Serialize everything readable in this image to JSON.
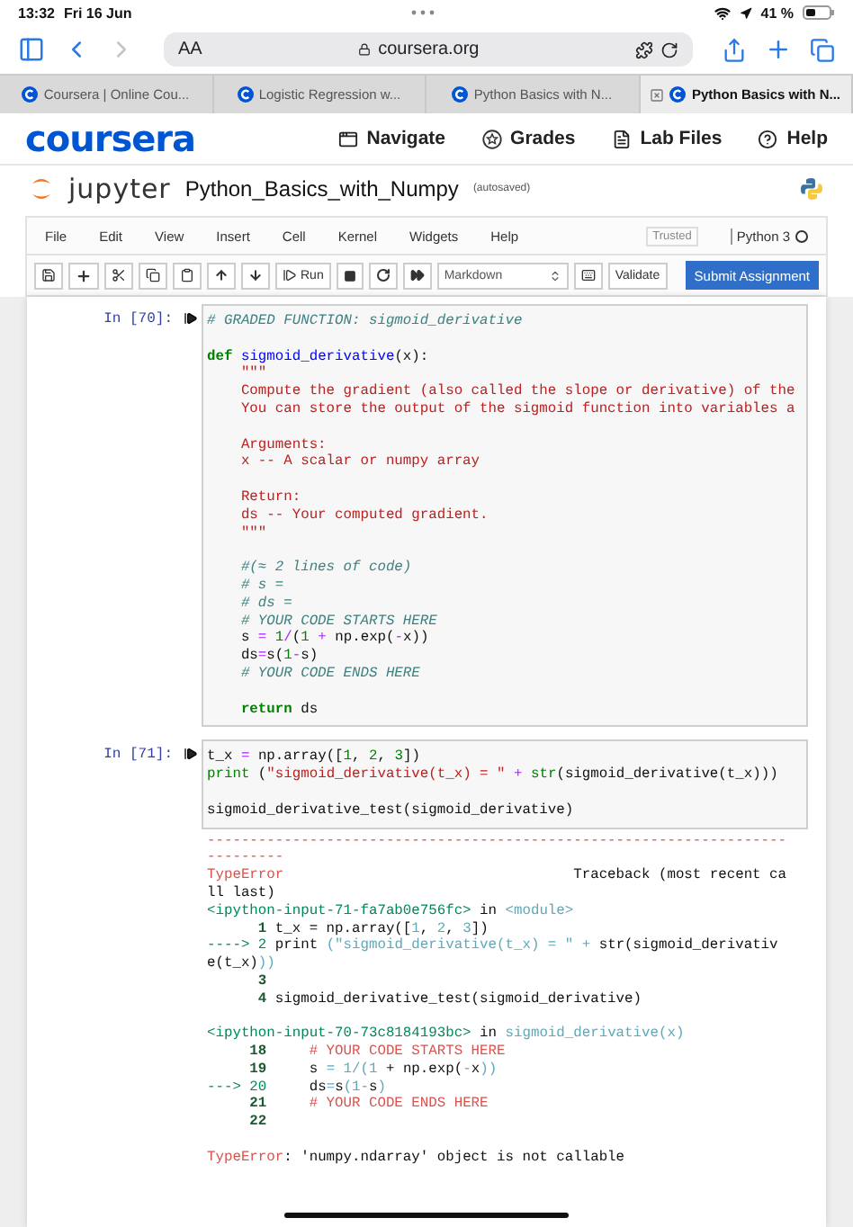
{
  "status_bar": {
    "time": "13:32",
    "date": "Fri 16 Jun",
    "battery": "41 %"
  },
  "browser": {
    "text_size": "AA",
    "address": "coursera.org",
    "forward_enabled": false
  },
  "tabs": [
    {
      "label": "Coursera | Online Cou...",
      "selected": false
    },
    {
      "label": "Logistic Regression w...",
      "selected": false
    },
    {
      "label": "Python Basics with N...",
      "selected": false
    },
    {
      "label": "Python Basics with N...",
      "selected": true
    }
  ],
  "site_nav": {
    "logo": "coursera",
    "items": [
      "Navigate",
      "Grades",
      "Lab Files",
      "Help"
    ]
  },
  "jupyter": {
    "logo": "jupyter",
    "notebook": "Python_Basics_with_Numpy",
    "status": "(autosaved)"
  },
  "menu": [
    "File",
    "Edit",
    "View",
    "Insert",
    "Cell",
    "Kernel",
    "Widgets",
    "Help"
  ],
  "trusted": "Trusted",
  "kernel": {
    "name": "Python 3",
    "busy": false
  },
  "toolbar": {
    "run": "Run",
    "cell_type": "Markdown",
    "validate": "Validate",
    "submit": "Submit Assignment"
  },
  "cells": [
    {
      "prompt": "In [70]:",
      "lines": [
        {
          "gap_before": false,
          "tokens": [
            {
              "text": "# GRADED FUNCTION: sigmoid_derivative",
              "kind": "comment"
            }
          ]
        },
        {
          "gap_before": true,
          "tokens": [
            {
              "text": "def",
              "kind": "keyword"
            },
            {
              "text": " sigmoid_derivative",
              "kind": "name"
            },
            {
              "text": "(x):"
            }
          ]
        },
        {
          "gap_before": false,
          "tokens": [
            {
              "text": "    \"\"\"",
              "kind": "string"
            }
          ]
        },
        {
          "gap_before": false,
          "tokens": [
            {
              "text": "    Compute the gradient (also called the slope or derivative) of the",
              "kind": "string"
            }
          ]
        },
        {
          "gap_before": false,
          "tokens": [
            {
              "text": "    You can store the output of the sigmoid function into variables a",
              "kind": "string"
            }
          ]
        },
        {
          "gap_before": true,
          "tokens": [
            {
              "text": "    Arguments:",
              "kind": "string"
            }
          ]
        },
        {
          "gap_before": false,
          "tokens": [
            {
              "text": "    x -- A scalar or numpy array",
              "kind": "string"
            }
          ]
        },
        {
          "gap_before": true,
          "tokens": [
            {
              "text": "    Return:",
              "kind": "string"
            }
          ]
        },
        {
          "gap_before": false,
          "tokens": [
            {
              "text": "    ds -- Your computed gradient.",
              "kind": "string"
            }
          ]
        },
        {
          "gap_before": false,
          "tokens": [
            {
              "text": "    \"\"\"",
              "kind": "string"
            }
          ]
        },
        {
          "gap_before": true,
          "tokens": [
            {
              "text": "    #(≈ 2 lines of code)",
              "kind": "comment"
            }
          ]
        },
        {
          "gap_before": false,
          "tokens": [
            {
              "text": "    # s = ",
              "kind": "comment"
            }
          ]
        },
        {
          "gap_before": false,
          "tokens": [
            {
              "text": "    # ds = ",
              "kind": "comment"
            }
          ]
        },
        {
          "gap_before": false,
          "tokens": [
            {
              "text": "    # YOUR CODE STARTS HERE",
              "kind": "comment"
            }
          ]
        },
        {
          "gap_before": false,
          "tokens": [
            {
              "text": "    s "
            },
            {
              "text": "= ",
              "kind": "operator"
            },
            {
              "text": "1",
              "kind": "number"
            },
            {
              "text": "/",
              "kind": "operator"
            },
            {
              "text": "("
            },
            {
              "text": "1",
              "kind": "number"
            },
            {
              "text": " + ",
              "kind": "operator"
            },
            {
              "text": "np.exp("
            },
            {
              "text": "-",
              "kind": "operator"
            },
            {
              "text": "x))"
            }
          ]
        },
        {
          "gap_before": false,
          "tokens": [
            {
              "text": "    ds"
            },
            {
              "text": "=",
              "kind": "operator"
            },
            {
              "text": "s("
            },
            {
              "text": "1",
              "kind": "number"
            },
            {
              "text": "-",
              "kind": "operator"
            },
            {
              "text": "s)"
            }
          ]
        },
        {
          "gap_before": false,
          "tokens": [
            {
              "text": "    # YOUR CODE ENDS HERE",
              "kind": "comment"
            }
          ]
        },
        {
          "gap_before": true,
          "tokens": [
            {
              "text": "    return",
              "kind": "keyword"
            },
            {
              "text": " ds"
            }
          ]
        }
      ]
    },
    {
      "prompt": "In [71]:",
      "lines": [
        {
          "gap_before": false,
          "tokens": [
            {
              "text": "t_x "
            },
            {
              "text": "=",
              "kind": "operator"
            },
            {
              "text": " np.array(["
            },
            {
              "text": "1",
              "kind": "number"
            },
            {
              "text": ", "
            },
            {
              "text": "2",
              "kind": "number"
            },
            {
              "text": ", "
            },
            {
              "text": "3",
              "kind": "number"
            },
            {
              "text": "])"
            }
          ]
        },
        {
          "gap_before": false,
          "tokens": [
            {
              "text": "print",
              "kind": "builtin"
            },
            {
              "text": " ("
            },
            {
              "text": "\"sigmoid_derivative(t_x) = \"",
              "kind": "string"
            },
            {
              "text": " + ",
              "kind": "operator"
            },
            {
              "text": "str",
              "kind": "builtin"
            },
            {
              "text": "(sigmoid_derivative(t_x)))"
            }
          ]
        },
        {
          "gap_before": true,
          "tokens": [
            {
              "text": "sigmoid_derivative_test(sigmoid_derivative)"
            }
          ]
        }
      ],
      "output": [
        {
          "gap_before": false,
          "tokens": [
            {
              "text": "--------------------------------------------------------------------",
              "kind": "error"
            }
          ]
        },
        {
          "gap_before": false,
          "tokens": [
            {
              "text": "---------",
              "kind": "error"
            }
          ]
        },
        {
          "gap_before": false,
          "tokens": [
            {
              "text": "TypeError",
              "kind": "error"
            },
            {
              "text": "                                  Traceback (most recent ca"
            }
          ]
        },
        {
          "gap_before": false,
          "tokens": [
            {
              "text": "ll last)"
            }
          ]
        },
        {
          "gap_before": false,
          "tokens": [
            {
              "text": "<ipython-input-71-fa7ab0e756fc>",
              "kind": "green"
            },
            {
              "text": " in "
            },
            {
              "text": "<module>",
              "kind": "cyan"
            }
          ]
        },
        {
          "gap_before": false,
          "tokens": [
            {
              "text": "      1",
              "kind": "lineno"
            },
            {
              "text": " t_x = np.array(["
            },
            {
              "text": "1",
              "kind": "cyan"
            },
            {
              "text": ", "
            },
            {
              "text": "2",
              "kind": "cyan"
            },
            {
              "text": ", "
            },
            {
              "text": "3",
              "kind": "cyan"
            },
            {
              "text": "])"
            }
          ]
        },
        {
          "gap_before": false,
          "tokens": [
            {
              "text": "----> 2",
              "kind": "green"
            },
            {
              "text": " print "
            },
            {
              "text": "(\"sigmoid_derivative(t_x) = \" + ",
              "kind": "cyan"
            },
            {
              "text": "str(sigmoid_derivativ"
            }
          ]
        },
        {
          "gap_before": false,
          "tokens": [
            {
              "text": "e(t_x)"
            },
            {
              "text": "))",
              "kind": "cyan"
            }
          ]
        },
        {
          "gap_before": false,
          "tokens": [
            {
              "text": "      3",
              "kind": "lineno"
            }
          ]
        },
        {
          "gap_before": false,
          "tokens": [
            {
              "text": "      4",
              "kind": "lineno"
            },
            {
              "text": " sigmoid_derivative_test(sigmoid_derivative)"
            }
          ]
        },
        {
          "gap_before": true,
          "tokens": [
            {
              "text": "<ipython-input-70-73c8184193bc>",
              "kind": "green"
            },
            {
              "text": " in "
            },
            {
              "text": "sigmoid_derivative(x)",
              "kind": "cyan"
            }
          ]
        },
        {
          "gap_before": false,
          "tokens": [
            {
              "text": "     18",
              "kind": "lineno"
            },
            {
              "text": "     # YOUR CODE STARTS HERE",
              "kind": "error"
            }
          ]
        },
        {
          "gap_before": false,
          "tokens": [
            {
              "text": "     19",
              "kind": "lineno"
            },
            {
              "text": "     s "
            },
            {
              "text": "= 1/(1",
              "kind": "cyan"
            },
            {
              "text": " + np.exp("
            },
            {
              "text": "-",
              "kind": "cyan"
            },
            {
              "text": "x"
            },
            {
              "text": "))",
              "kind": "cyan"
            }
          ]
        },
        {
          "gap_before": false,
          "tokens": [
            {
              "text": "---> 20",
              "kind": "green"
            },
            {
              "text": "     ds"
            },
            {
              "text": "=",
              "kind": "cyan"
            },
            {
              "text": "s"
            },
            {
              "text": "(1-",
              "kind": "cyan"
            },
            {
              "text": "s"
            },
            {
              "text": ")",
              "kind": "cyan"
            }
          ]
        },
        {
          "gap_before": false,
          "tokens": [
            {
              "text": "     21",
              "kind": "lineno"
            },
            {
              "text": "     # YOUR CODE ENDS HERE",
              "kind": "error"
            }
          ]
        },
        {
          "gap_before": false,
          "tokens": [
            {
              "text": "     22",
              "kind": "lineno"
            }
          ]
        },
        {
          "gap_before": true,
          "tokens": [
            {
              "text": "TypeError",
              "kind": "error"
            },
            {
              "text": ": 'numpy.ndarray' object is not callable"
            }
          ]
        }
      ]
    }
  ]
}
